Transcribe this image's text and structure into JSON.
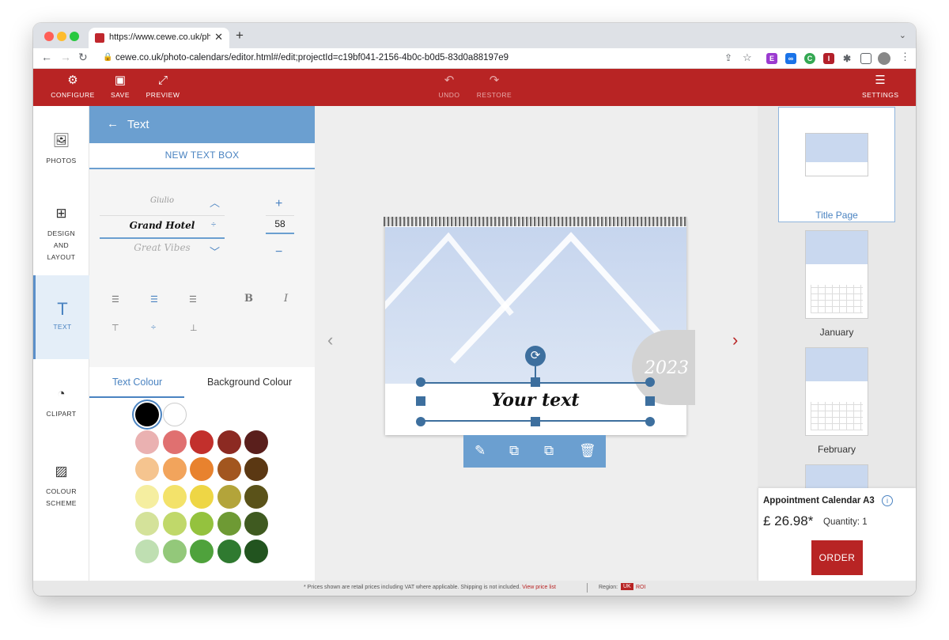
{
  "browser": {
    "tab_title": "https://www.cewe.co.uk/photo",
    "tab_close": "✕",
    "new_tab": "+",
    "url": "cewe.co.uk/photo-calendars/editor.html#/edit;projectId=c19bf041-2156-4b0c-b0d5-83d0a88197e9"
  },
  "toolbar": {
    "configure": "CONFIGURE",
    "save": "SAVE",
    "preview": "PREVIEW",
    "undo": "UNDO",
    "restore": "RESTORE",
    "settings": "SETTINGS"
  },
  "leftnav": {
    "photos": "PHOTOS",
    "design_l1": "DESIGN",
    "design_l2": "AND",
    "design_l3": "LAYOUT",
    "text": "TEXT",
    "clipart": "CLIPART",
    "colour_l1": "COLOUR",
    "colour_l2": "SCHEME"
  },
  "panel": {
    "title": "Text",
    "new_text_box": "NEW TEXT BOX",
    "fonts": [
      "Giulio",
      "Grand Hotel",
      "Great Vibes"
    ],
    "font_size": "58",
    "tab_text_colour": "Text Colour",
    "tab_background_colour": "Background Colour",
    "swatch_colors": [
      [
        "#000000",
        "#ffffff"
      ],
      [
        "#eab1b1",
        "#e07070",
        "#c2302c",
        "#8c2a22",
        "#5a1f1c"
      ],
      [
        "#f5c48f",
        "#f2a45c",
        "#e8822e",
        "#a2561f",
        "#5b3813"
      ],
      [
        "#f5eea0",
        "#f3e26a",
        "#eed645",
        "#b3a43a",
        "#5a5219"
      ],
      [
        "#d4e29a",
        "#c0d86a",
        "#94c23e",
        "#6e9a34",
        "#3f5a20"
      ],
      [
        "#bfdfb2",
        "#93c87a",
        "#4fa23c",
        "#2f7a30",
        "#22541f"
      ]
    ]
  },
  "canvas": {
    "year": "2023",
    "text": "Your text"
  },
  "thumbs": {
    "title_page": "Title Page",
    "january": "January",
    "february": "February"
  },
  "order": {
    "product": "Appointment Calendar A3",
    "price": "£ 26.98*",
    "quantity": "Quantity: 1",
    "button": "ORDER"
  },
  "footer": {
    "note": "* Prices shown are retail prices including VAT where applicable. Shipping is not included.",
    "link": "View price list",
    "region_label": "Region:",
    "uk": "UK",
    "roi": "ROI"
  }
}
